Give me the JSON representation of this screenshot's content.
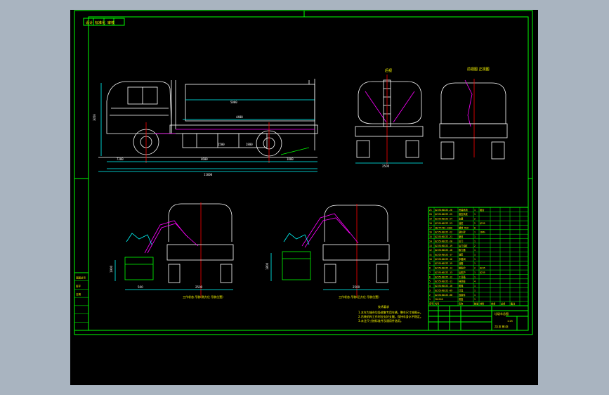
{
  "colors": {
    "background": "#a9b4c0",
    "canvas": "#000000",
    "frame": "#00ff00",
    "geometry": "#ffffff",
    "centerline": "#ff0000",
    "dimension": "#00ffff",
    "accent": "#ff00ff",
    "text": "#ffff00"
  },
  "side_view": {
    "dims": [
      "7300",
      "4600",
      "1800",
      "11600",
      "5000",
      "4400",
      "3050",
      "1500",
      "2800"
    ]
  },
  "rear_view": {
    "title": "后视",
    "width_dim": "2500"
  },
  "front_view": {
    "title": "前视图 正视图"
  },
  "crane_views": [
    {
      "caption": "工作状态 吊装(侧方位 吊装位置)",
      "dims": [
        "1900",
        "500",
        "2500"
      ]
    },
    {
      "caption": "工作状态 吊装(后方位 吊装位置)",
      "dims": [
        "1800",
        "2500"
      ]
    }
  ],
  "notes": {
    "heading": "技术要求",
    "lines": [
      "1.本车为城市垃圾收集专用车辆，整车尺寸按图示。",
      "2.吊装机构工作时应支好支腿，保持车身水平稳定。",
      "3.未注尺寸按标准件及通用件选用。"
    ]
  },
  "bom_rows": [
    [
      "21",
      "QZJ5160ZZZ-26",
      "吊装机构",
      "1",
      "组合",
      "",
      "",
      "",
      ""
    ],
    [
      "20",
      "QZJ5160ZZZ-25",
      "液压系统",
      "1",
      "",
      "",
      "",
      "",
      ""
    ],
    [
      "19",
      "QZJ5160ZZZ-24",
      "支腿",
      "2",
      "",
      "",
      "",
      "",
      ""
    ],
    [
      "18",
      "QZJ5160ZZZ-23",
      "油缸",
      "2",
      "Q235",
      "",
      "",
      "",
      ""
    ],
    [
      "17",
      "GB/T5783-2000",
      "螺栓 M16",
      "8",
      "",
      "",
      "",
      "",
      ""
    ],
    [
      "16",
      "QZJ5160ZZZ-22",
      "副车架",
      "1",
      "16Mn",
      "",
      "",
      "",
      ""
    ],
    [
      "15",
      "QZJ5160ZZZ-21",
      "罐体",
      "1",
      "",
      "",
      "",
      "",
      ""
    ],
    [
      "14",
      "QZJ5160ZZZ-20",
      "后门",
      "1",
      "",
      "",
      "",
      "",
      ""
    ],
    [
      "13",
      "QZJ5160ZZZ-19",
      "后门油缸",
      "2",
      "",
      "",
      "",
      "",
      ""
    ],
    [
      "12",
      "QZJ5160ZZZ-18",
      "取力器",
      "1",
      "",
      "",
      "",
      "",
      ""
    ],
    [
      "11",
      "QZJ5160ZZZ-17",
      "油泵",
      "1",
      "",
      "",
      "",
      "",
      ""
    ],
    [
      "10",
      "QZJ5160ZZZ-16",
      "多路阀",
      "1",
      "",
      "",
      "",
      "",
      ""
    ],
    [
      "9",
      "QZJ5160ZZZ-15",
      "油箱",
      "1",
      "",
      "",
      "",
      "",
      ""
    ],
    [
      "8",
      "QZJ5160ZZZ-14",
      "侧防护",
      "2",
      "Q235",
      "",
      "",
      "",
      ""
    ],
    [
      "7",
      "QZJ5160ZZZ-13",
      "后防护",
      "1",
      "Q235",
      "",
      "",
      "",
      ""
    ],
    [
      "6",
      "QZJ5160ZZZ-12",
      "工具箱",
      "1",
      "",
      "",
      "",
      "",
      ""
    ],
    [
      "5",
      "QZJ5160ZZZ-11",
      "挡泥板",
      "4",
      "",
      "",
      "",
      "",
      ""
    ],
    [
      "4",
      "QZJ5160ZZZ-10",
      "爬梯",
      "1",
      "",
      "",
      "",
      "",
      ""
    ],
    [
      "3",
      "QZJ5160ZZZ-09",
      "灯具",
      "1",
      "",
      "",
      "",
      "",
      ""
    ],
    [
      "2",
      "QZJ5160ZZZ-08",
      "连接件",
      "1",
      "",
      "",
      "",
      "",
      ""
    ],
    [
      "1",
      "CA1160",
      "底盘",
      "1",
      "",
      "",
      "",
      "",
      ""
    ]
  ],
  "bom_header": [
    "序号",
    "代号",
    "名称",
    "数量",
    "材料",
    "单重",
    "总重",
    "备注",
    ""
  ],
  "title_block": {
    "name": "垃圾车总图",
    "scale": "1:25",
    "sheet": "共1张 第1张"
  },
  "revision_block": {
    "rows": [
      "底图总号",
      "签字",
      "日期",
      "",
      "",
      "",
      ""
    ]
  },
  "corner_block": {
    "label": "设计 标准化 审核"
  }
}
